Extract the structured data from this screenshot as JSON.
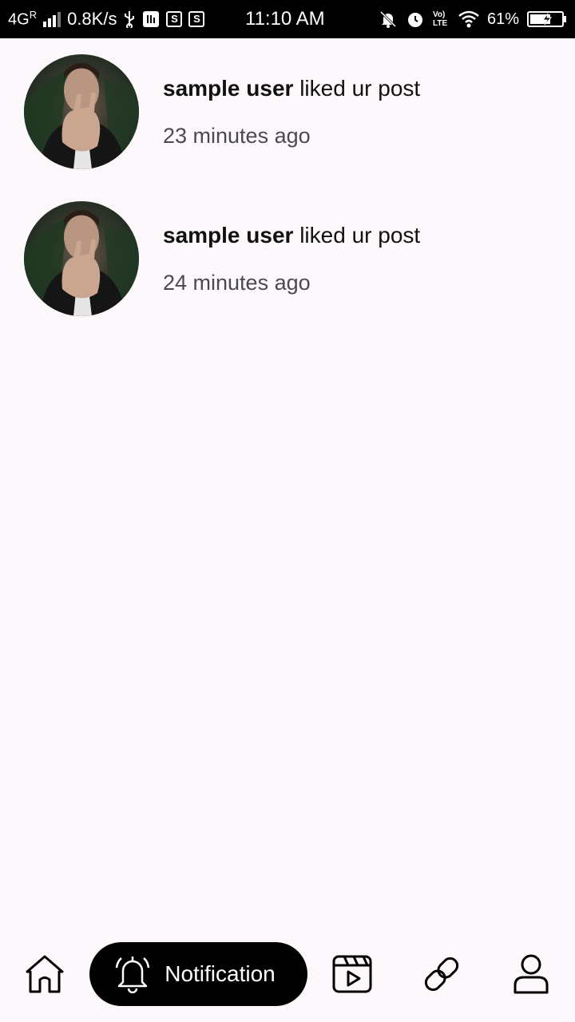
{
  "status_bar": {
    "network": "4G",
    "roaming": "R",
    "speed": "0.8K/s",
    "time": "11:10 AM",
    "volte": "Vo) LTE",
    "battery": "61%",
    "badge_s": "S"
  },
  "notifications": [
    {
      "username": "sample user",
      "action": " liked ur post",
      "time": "23 minutes ago"
    },
    {
      "username": "sample user",
      "action": " liked ur post",
      "time": "24 minutes ago"
    }
  ],
  "bottom_nav": {
    "active_label": "Notification",
    "items": [
      "home-icon",
      "bell-icon",
      "reels-icon",
      "link-icon",
      "profile-icon"
    ]
  },
  "colors": {
    "background": "#fdf8fc",
    "active_pill": "#000000",
    "status_bar": "#000000"
  }
}
